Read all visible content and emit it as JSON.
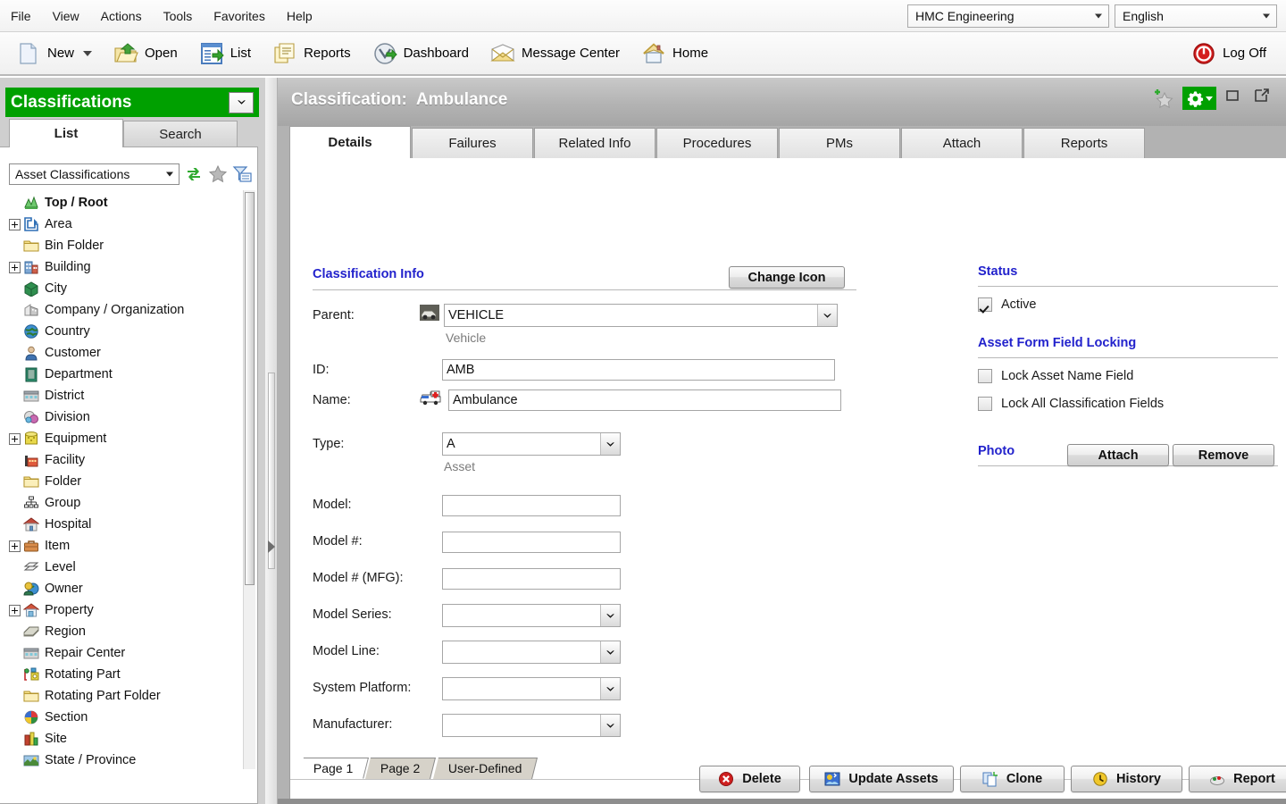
{
  "menubar": {
    "items": [
      {
        "label": "File"
      },
      {
        "label": "View"
      },
      {
        "label": "Actions"
      },
      {
        "label": "Tools"
      },
      {
        "label": "Favorites"
      },
      {
        "label": "Help"
      }
    ],
    "org_select": {
      "value": "HMC Engineering"
    },
    "language_select": {
      "value": "English"
    }
  },
  "toolbar": {
    "new_label": "New",
    "open_label": "Open",
    "list_label": "List",
    "reports_label": "Reports",
    "dashboard_label": "Dashboard",
    "message_center_label": "Message Center",
    "home_label": "Home",
    "logoff_label": "Log Off"
  },
  "sidebar": {
    "title": "Classifications",
    "tabs": [
      {
        "label": "List",
        "active": true
      },
      {
        "label": "Search",
        "active": false
      }
    ],
    "classification_select": {
      "value": "Asset Classifications"
    },
    "tree": [
      {
        "label": "Top / Root",
        "expander": "none",
        "icon": "top-root-icon",
        "indent": 0,
        "root": true
      },
      {
        "label": "Area",
        "expander": "plus",
        "icon": "area-icon",
        "indent": 0
      },
      {
        "label": "Bin Folder",
        "expander": "none",
        "icon": "folder-icon",
        "indent": 0
      },
      {
        "label": "Building",
        "expander": "plus",
        "icon": "building-icon",
        "indent": 0
      },
      {
        "label": "City",
        "expander": "none",
        "icon": "city-icon",
        "indent": 0
      },
      {
        "label": "Company / Organization",
        "expander": "none",
        "icon": "company-icon",
        "indent": 0
      },
      {
        "label": "Country",
        "expander": "none",
        "icon": "globe-icon",
        "indent": 0
      },
      {
        "label": "Customer",
        "expander": "none",
        "icon": "person-icon",
        "indent": 0
      },
      {
        "label": "Department",
        "expander": "none",
        "icon": "department-icon",
        "indent": 0
      },
      {
        "label": "District",
        "expander": "none",
        "icon": "district-icon",
        "indent": 0
      },
      {
        "label": "Division",
        "expander": "none",
        "icon": "division-icon",
        "indent": 0
      },
      {
        "label": "Equipment",
        "expander": "plus",
        "icon": "equipment-icon",
        "indent": 0
      },
      {
        "label": "Facility",
        "expander": "none",
        "icon": "facility-icon",
        "indent": 0
      },
      {
        "label": "Folder",
        "expander": "none",
        "icon": "folder-icon",
        "indent": 0
      },
      {
        "label": "Group",
        "expander": "none",
        "icon": "group-icon",
        "indent": 0
      },
      {
        "label": "Hospital",
        "expander": "none",
        "icon": "hospital-icon",
        "indent": 0
      },
      {
        "label": "Item",
        "expander": "plus",
        "icon": "item-icon",
        "indent": 0
      },
      {
        "label": "Level",
        "expander": "none",
        "icon": "level-icon",
        "indent": 0
      },
      {
        "label": "Owner",
        "expander": "none",
        "icon": "owner-icon",
        "indent": 0
      },
      {
        "label": "Property",
        "expander": "plus",
        "icon": "property-icon",
        "indent": 0
      },
      {
        "label": "Region",
        "expander": "none",
        "icon": "region-icon",
        "indent": 0
      },
      {
        "label": "Repair Center",
        "expander": "none",
        "icon": "repair-center-icon",
        "indent": 0
      },
      {
        "label": "Rotating Part",
        "expander": "none",
        "icon": "rotating-part-icon",
        "indent": 0
      },
      {
        "label": "Rotating Part Folder",
        "expander": "none",
        "icon": "folder-icon",
        "indent": 0
      },
      {
        "label": "Section",
        "expander": "none",
        "icon": "section-icon",
        "indent": 0
      },
      {
        "label": "Site",
        "expander": "none",
        "icon": "site-icon",
        "indent": 0
      },
      {
        "label": "State / Province",
        "expander": "none",
        "icon": "state-icon",
        "indent": 0
      }
    ]
  },
  "main": {
    "title_prefix": "Classification:",
    "title_value": "Ambulance",
    "tabs": [
      {
        "label": "Details",
        "active": true
      },
      {
        "label": "Failures",
        "active": false
      },
      {
        "label": "Related Info",
        "active": false
      },
      {
        "label": "Procedures",
        "active": false
      },
      {
        "label": "PMs",
        "active": false
      },
      {
        "label": "Attach",
        "active": false
      },
      {
        "label": "Reports",
        "active": false
      }
    ]
  },
  "form": {
    "section_title": "Classification Info",
    "change_icon_label": "Change Icon",
    "parent": {
      "label": "Parent:",
      "value": "VEHICLE",
      "subtext": "Vehicle"
    },
    "id": {
      "label": "ID:",
      "value": "AMB"
    },
    "name": {
      "label": "Name:",
      "value": "Ambulance"
    },
    "type": {
      "label": "Type:",
      "value": "A",
      "subtext": "Asset"
    },
    "model": {
      "label": "Model:",
      "value": ""
    },
    "model_num": {
      "label": "Model #:",
      "value": ""
    },
    "model_num_mfg": {
      "label": "Model # (MFG):",
      "value": ""
    },
    "model_series": {
      "label": "Model Series:",
      "value": ""
    },
    "model_line": {
      "label": "Model Line:",
      "value": ""
    },
    "system_platform": {
      "label": "System Platform:",
      "value": ""
    },
    "manufacturer": {
      "label": "Manufacturer:",
      "value": ""
    }
  },
  "right_panel": {
    "status_title": "Status",
    "active": {
      "label": "Active",
      "checked": true
    },
    "locking_title": "Asset Form Field Locking",
    "lock_asset_name": {
      "label": "Lock Asset Name Field",
      "checked": false
    },
    "lock_all_fields": {
      "label": "Lock All Classification Fields",
      "checked": false
    },
    "photo_title": "Photo",
    "attach_label": "Attach",
    "remove_label": "Remove"
  },
  "page_tabs": [
    {
      "label": "Page 1",
      "active": true
    },
    {
      "label": "Page 2",
      "active": false
    },
    {
      "label": "User-Defined",
      "active": false
    }
  ],
  "bottom_buttons": {
    "delete_label": "Delete",
    "update_assets_label": "Update Assets",
    "clone_label": "Clone",
    "history_label": "History",
    "report_label": "Report"
  },
  "colors": {
    "brand_green": "#00a000",
    "heading_blue": "#2222cc",
    "header_gray": "#b3b3b3",
    "accent_orange": "#f0a000"
  }
}
